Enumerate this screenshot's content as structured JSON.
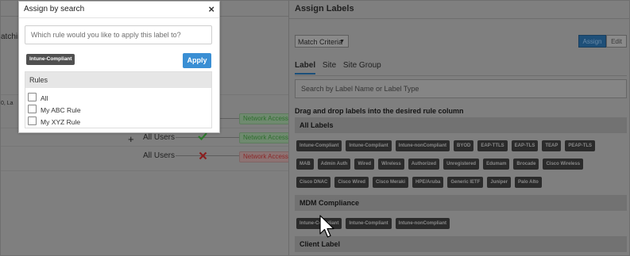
{
  "background": {
    "partial_label": "atchin",
    "small_label": "0, La",
    "rows": [
      {
        "user": "",
        "action": "Network Access Al",
        "status": "allow"
      },
      {
        "user": "All Users",
        "action": "Network Access Al",
        "status": "allow"
      },
      {
        "user": "All Users",
        "action": "Network Access De",
        "status": "deny"
      }
    ],
    "plus": "+"
  },
  "assign_labels": {
    "title": "Assign Labels",
    "match_criteria": "Match Criteria",
    "assign_label": "Assign",
    "edit_label": "Edit",
    "tabs": [
      "Label",
      "Site",
      "Site Group"
    ],
    "search_placeholder": "Search by Label Name or Label Type",
    "drag_hint": "Drag and drop labels into the desired rule column",
    "sections": [
      {
        "name": "All Labels",
        "rows": [
          [
            "Intune-Compliant",
            "Intune-Compliant",
            "Intune-nonCompliant",
            "BYOD",
            "EAP-TTLS",
            "EAP-TLS",
            "TEAP",
            "PEAP-TLS"
          ],
          [
            "MAB",
            "Admin Auth",
            "Wired",
            "Wireless",
            "Authorized",
            "Unregistered",
            "Edumam",
            "Brocade",
            "Cisco Wireless"
          ],
          [
            "Cisco DNAC",
            "Cisco Wired",
            "Cisco Meraki",
            "HPE/Aruba",
            "Generic IETF",
            "Juniper",
            "Palo Alto"
          ]
        ]
      },
      {
        "name": "MDM Compliance",
        "rows": [
          [
            "Intune-Compliant",
            "Intune-Compliant",
            "Intune-nonCompliant"
          ]
        ]
      },
      {
        "name": "Client Label",
        "rows": []
      }
    ]
  },
  "modal": {
    "title": "Assign by search",
    "close": "×",
    "search_placeholder": "Which rule would you like to apply this label to?",
    "selected_label": "Intune-Compliant",
    "apply": "Apply",
    "rules_header": "Rules",
    "rules": [
      "All",
      "My ABC Rule",
      "My XYZ Rule"
    ]
  },
  "colors": {
    "apply_button": "#3a8fd4",
    "assign_active": "#1e4f78",
    "label_tag": "#2b2b2b"
  }
}
